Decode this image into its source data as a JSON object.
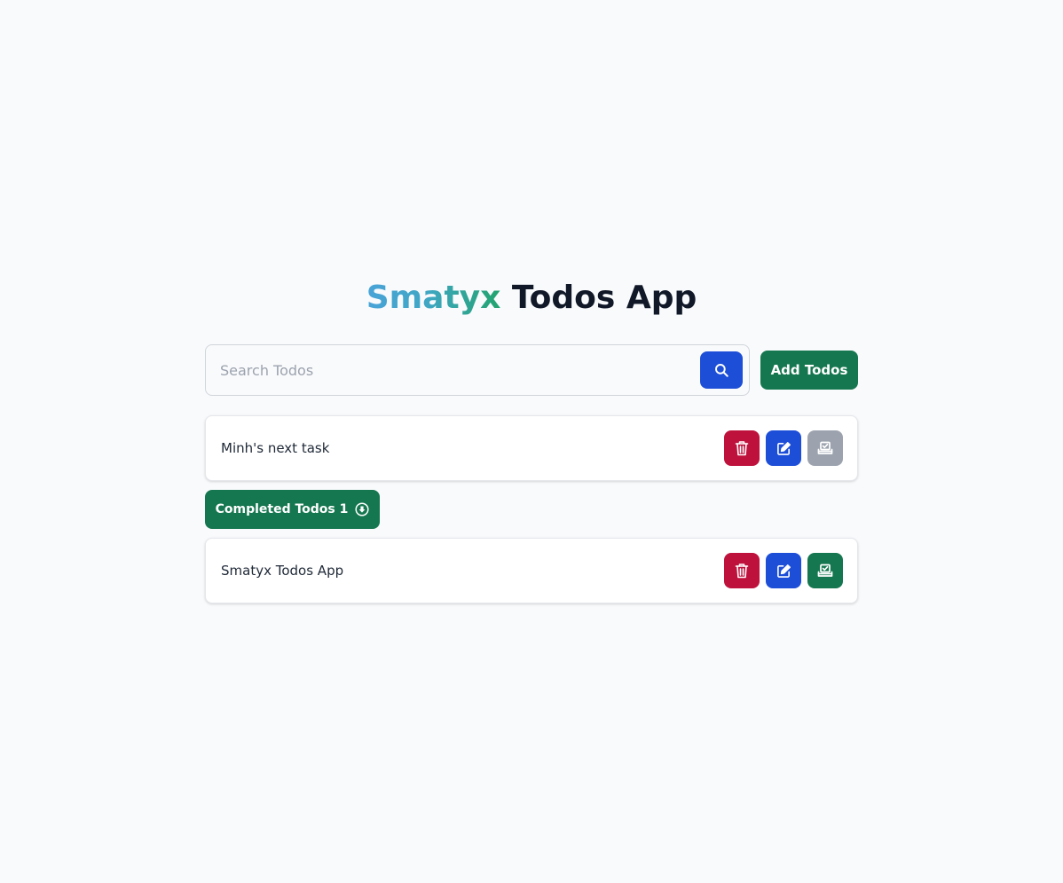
{
  "header": {
    "brand": "Smatyx",
    "title_rest": " Todos App"
  },
  "search": {
    "placeholder": "Search Todos",
    "value": "",
    "button_icon": "search-icon"
  },
  "add_button_label": "Add Todos",
  "pending_todos": [
    {
      "text": "Minh's next task",
      "icons": [
        "trash-icon",
        "edit-icon",
        "check-tray-icon"
      ]
    }
  ],
  "completed_section": {
    "label": "Completed Todos",
    "count": "1",
    "icon": "arrow-down-circle-icon"
  },
  "completed_todos": [
    {
      "text": "Smatyx Todos App",
      "icons": [
        "trash-icon",
        "edit-icon",
        "check-tray-icon"
      ]
    }
  ],
  "colors": {
    "background": "#f8fafc",
    "primary_blue": "#1d4ed8",
    "success_green": "#15774f",
    "danger_red": "#be123c",
    "muted_gray": "#9ca3af",
    "brand_gradient_start": "#4aa3d8",
    "brand_gradient_end": "#22a36e"
  }
}
